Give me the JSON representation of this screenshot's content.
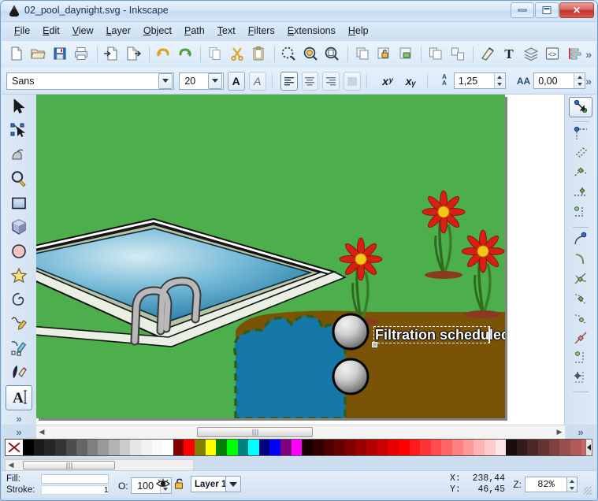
{
  "window": {
    "title": "02_pool_daynight.svg - Inkscape",
    "app_icon": "inkscape-logo-icon",
    "buttons": {
      "minimize": "minimize-icon",
      "maximize": "maximize-icon",
      "close": "✕"
    }
  },
  "menu": {
    "items": [
      "File",
      "Edit",
      "View",
      "Layer",
      "Object",
      "Path",
      "Text",
      "Filters",
      "Extensions",
      "Help"
    ]
  },
  "command_toolbar": {
    "overflow_label": "»",
    "buttons": [
      {
        "name": "new-document-button",
        "icon": "new-document-icon"
      },
      {
        "name": "open-document-button",
        "icon": "open-folder-icon"
      },
      {
        "name": "save-document-button",
        "icon": "save-floppy-icon"
      },
      {
        "name": "print-document-button",
        "icon": "printer-icon"
      },
      {
        "sep": true
      },
      {
        "name": "import-button",
        "icon": "import-icon"
      },
      {
        "name": "export-button",
        "icon": "export-icon"
      },
      {
        "sep": true
      },
      {
        "name": "undo-button",
        "icon": "undo-arrow-icon"
      },
      {
        "name": "redo-button",
        "icon": "redo-arrow-icon"
      },
      {
        "sep": true
      },
      {
        "name": "copy-button",
        "icon": "copy-icon"
      },
      {
        "name": "cut-button",
        "icon": "scissors-icon"
      },
      {
        "name": "paste-button",
        "icon": "clipboard-icon"
      },
      {
        "sep": true
      },
      {
        "name": "zoom-selection-button",
        "icon": "zoom-selection-icon"
      },
      {
        "name": "zoom-drawing-button",
        "icon": "zoom-drawing-icon"
      },
      {
        "name": "zoom-page-button",
        "icon": "zoom-page-icon"
      },
      {
        "sep": true
      },
      {
        "name": "duplicate-button",
        "icon": "duplicate-icon"
      },
      {
        "name": "clone-button",
        "icon": "clone-lock-icon"
      },
      {
        "name": "unlink-clone-button",
        "icon": "unlink-clone-icon"
      },
      {
        "sep": true
      },
      {
        "name": "group-button",
        "icon": "group-icon"
      },
      {
        "name": "ungroup-button",
        "icon": "ungroup-icon"
      },
      {
        "sep": true
      },
      {
        "name": "fill-stroke-dialog-button",
        "icon": "fill-stroke-icon"
      },
      {
        "name": "text-dialog-button",
        "icon": "text-T-icon"
      },
      {
        "name": "layers-dialog-button",
        "icon": "layers-icon"
      },
      {
        "name": "xml-editor-button",
        "icon": "xml-editor-icon"
      },
      {
        "name": "align-dialog-button",
        "icon": "align-distribute-icon"
      }
    ]
  },
  "text_toolbar": {
    "font_family": "Sans",
    "font_size": "20",
    "bold_label": "A",
    "italic_label": "A",
    "align": [
      "align-left-icon",
      "align-center-icon",
      "align-right-icon",
      "align-justify-icon"
    ],
    "selected_align": 0,
    "superscript_label": "xʸ",
    "subscript_label": "xᵧ",
    "line_spacing_label": "A̲A",
    "line_spacing_value": "1,25",
    "letter_spacing_label": "AA",
    "letter_spacing_value": "0,00",
    "overflow_label": "»"
  },
  "toolbox": {
    "overflow_label": "»",
    "tools": [
      {
        "name": "selector-tool",
        "icon": "arrow-pointer-icon",
        "selected": false
      },
      {
        "name": "node-editor-tool",
        "icon": "node-edit-icon",
        "selected": false
      },
      {
        "name": "tweak-tool",
        "icon": "tweak-icon",
        "selected": false
      },
      {
        "name": "zoom-tool",
        "icon": "magnifier-icon",
        "selected": false
      },
      {
        "name": "rectangle-tool",
        "icon": "rectangle-icon",
        "selected": false
      },
      {
        "name": "box3d-tool",
        "icon": "cube-3d-icon",
        "selected": false
      },
      {
        "name": "ellipse-tool",
        "icon": "circle-icon",
        "selected": false
      },
      {
        "name": "star-tool",
        "icon": "star-icon",
        "selected": false
      },
      {
        "name": "spiral-tool",
        "icon": "spiral-icon",
        "selected": false
      },
      {
        "name": "pencil-tool",
        "icon": "pencil-icon",
        "selected": false
      },
      {
        "name": "pen-tool",
        "icon": "bezier-pen-icon",
        "selected": false
      },
      {
        "name": "calligraphy-tool",
        "icon": "calligraphy-pen-icon",
        "selected": false
      },
      {
        "name": "text-tool",
        "icon": "text-A-icon",
        "selected": true
      }
    ]
  },
  "snap_toolbar": {
    "buttons": [
      {
        "name": "enable-snapping-toggle",
        "icon": "snap-master-icon",
        "selected": true
      },
      {
        "sep": true
      },
      {
        "name": "snap-bounding-boxes",
        "icon": "snap-bbox-icon"
      },
      {
        "name": "snap-bbox-edges",
        "icon": "snap-bbox-edge-icon"
      },
      {
        "name": "snap-bbox-corners",
        "icon": "snap-bbox-corner-icon"
      },
      {
        "name": "snap-bbox-edge-midpoints",
        "icon": "snap-bbox-edge-mid-icon"
      },
      {
        "name": "snap-bbox-centers",
        "icon": "snap-bbox-center-icon"
      },
      {
        "sep": true
      },
      {
        "name": "snap-nodes-paths",
        "icon": "snap-node-icon"
      },
      {
        "name": "snap-paths",
        "icon": "snap-path-icon"
      },
      {
        "name": "snap-path-intersections",
        "icon": "snap-path-intersection-icon"
      },
      {
        "name": "snap-cusp-nodes",
        "icon": "snap-cusp-node-icon"
      },
      {
        "name": "snap-smooth-nodes",
        "icon": "snap-smooth-node-icon"
      },
      {
        "name": "snap-midpoints-line-segments",
        "icon": "snap-line-midpoint-icon"
      },
      {
        "name": "snap-object-centers",
        "icon": "snap-object-center-icon"
      },
      {
        "name": "snap-rotation-centers",
        "icon": "snap-rotation-center-icon"
      },
      {
        "sep": true
      }
    ]
  },
  "canvas": {
    "zoom_1to1_icon": "zoom-1-1-icon",
    "hscroll_left_icon": "◀",
    "hscroll_right_icon": "▶",
    "overflow_left": "»",
    "overflow_right": "»",
    "drawing": {
      "description": "isometric swimming pool with lawn, flowers, dirt area and two grey spheres",
      "grass_color": "#4caf4c",
      "dirt_color": "#7a5307",
      "pool_water_top": "#bcdcec",
      "pool_water_bottom": "#1f7ba5",
      "pool_rim_color": "#e8eee2",
      "pool_rim_side": "#b8c2a4",
      "puddle_color": "#1678a8",
      "puddle_dash_color": "#2d5d1e",
      "flower_petal_color": "#d81f12",
      "flower_center_color": "#f5c518",
      "stem_color": "#2e6b1f",
      "mound_color": "#8a3a20",
      "ladder_color": "#b9b9b9",
      "sphere_light": "#e8e8e8",
      "sphere_dark": "#6f6f6f",
      "selected_text": "Filtration scheduled"
    }
  },
  "palette": {
    "none_swatch": "no-color-X-icon",
    "scroll_right_icon": "▶",
    "colors": [
      "#000000",
      "#1a1a1a",
      "#262626",
      "#333333",
      "#4d4d4d",
      "#666666",
      "#808080",
      "#999999",
      "#b3b3b3",
      "#cccccc",
      "#e6e6e6",
      "#f2f2f2",
      "#fafafa",
      "#ffffff",
      "#800000",
      "#ff0000",
      "#808000",
      "#ffff00",
      "#008000",
      "#00ff00",
      "#008080",
      "#00ffff",
      "#000080",
      "#0000ff",
      "#800080",
      "#ff00ff",
      "#1a0000",
      "#330000",
      "#4d0000",
      "#660000",
      "#800000",
      "#990000",
      "#b30000",
      "#cc0000",
      "#e60000",
      "#ff0000",
      "#ff1a1a",
      "#ff3333",
      "#ff4d4d",
      "#ff6666",
      "#ff8080",
      "#ff9999",
      "#ffb3b3",
      "#ffcccc",
      "#ffe6e6",
      "#1a0d0d",
      "#331a1a",
      "#4d2626",
      "#663333",
      "#804040",
      "#994d4d",
      "#b35959",
      "#cc6666"
    ]
  },
  "statusbar": {
    "fill_label": "Fill:",
    "stroke_label": "Stroke:",
    "stroke_width": "1",
    "opacity_label": "O:",
    "opacity_value": "100",
    "visibility_icon": "eye-open-icon",
    "lock_icon": "lock-open-icon",
    "layer_name": "Layer 1",
    "x_label": "X:",
    "x_value": "238,44",
    "y_label": "Y:",
    "y_value": "46,45",
    "zoom_label": "Z:",
    "zoom_value": "82%"
  }
}
